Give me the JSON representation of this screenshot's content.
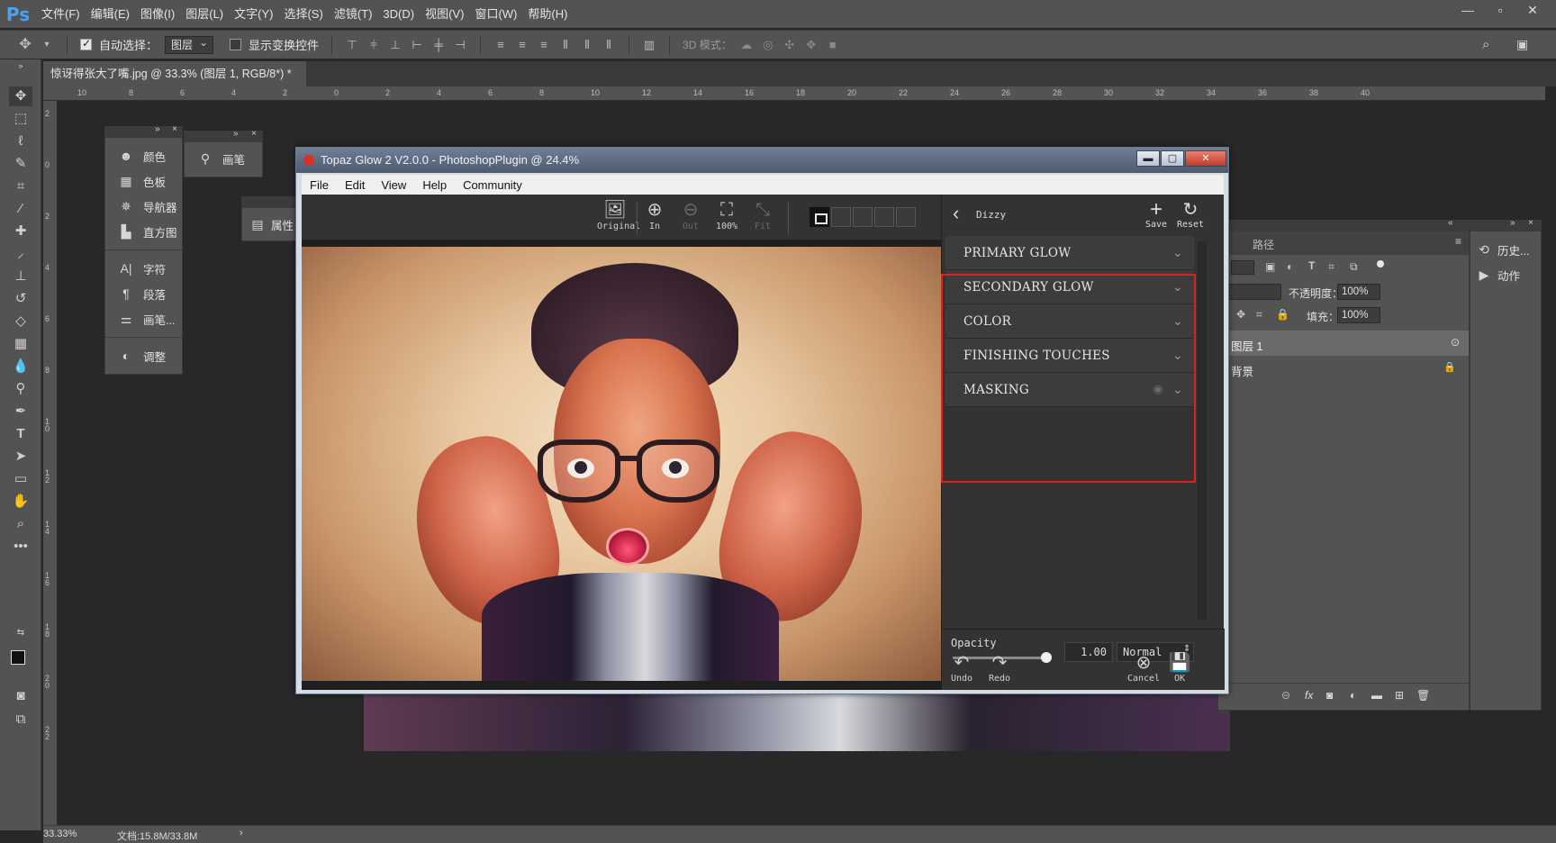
{
  "photoshop": {
    "logo": "Ps",
    "menu": [
      "文件(F)",
      "编辑(E)",
      "图像(I)",
      "图层(L)",
      "文字(Y)",
      "选择(S)",
      "滤镜(T)",
      "3D(D)",
      "视图(V)",
      "窗口(W)",
      "帮助(H)"
    ],
    "options": {
      "auto_select_label": "自动选择：",
      "auto_select_value": "图层",
      "auto_select_checked": true,
      "show_transform_label": "显示变换控件",
      "show_transform_checked": false,
      "mode_3d_label": "3D 模式："
    },
    "document_tab": "惊讶得张大了嘴.jpg @ 33.3% (图层 1, RGB/8*) *",
    "ruler_top_labels": [
      "10",
      "8",
      "6",
      "4",
      "2",
      "0",
      "2",
      "4",
      "6",
      "8",
      "10",
      "12",
      "14",
      "16",
      "18",
      "20",
      "22",
      "24",
      "26",
      "28",
      "30",
      "32",
      "34",
      "36",
      "38",
      "40"
    ],
    "ruler_left_labels": [
      "2",
      "0",
      "2",
      "4",
      "6",
      "8",
      "1 0",
      "1 2",
      "1 4",
      "1 6",
      "1 8",
      "2 0",
      "2 2"
    ],
    "status": {
      "zoom": "33.33%",
      "doc_info": "文档:15.8M/33.8M",
      "arrow": "›"
    }
  },
  "panels": {
    "left_group": [
      {
        "icon": "palette-icon",
        "label": "颜色"
      },
      {
        "icon": "swatches-icon",
        "label": "色板"
      },
      {
        "icon": "navigator-icon",
        "label": "导航器"
      },
      {
        "icon": "histogram-icon",
        "label": "直方图"
      },
      {
        "icon": "character-icon",
        "label": "字符"
      },
      {
        "icon": "paragraph-icon",
        "label": "段落"
      },
      {
        "icon": "brush-settings-icon",
        "label": "画笔..."
      },
      {
        "icon": "adjustments-icon",
        "label": "调整"
      }
    ],
    "brush_panel_label": "画笔",
    "properties_panel_label": "属性",
    "layers": {
      "paths_tab": "路径",
      "opacity_label": "不透明度：",
      "opacity_value": "100%",
      "fill_label": "填充：",
      "fill_value": "100%",
      "rows": [
        "图层 1",
        "背景"
      ]
    },
    "side": {
      "history": "历史...",
      "actions": "动作"
    }
  },
  "topaz": {
    "title": "Topaz Glow 2 V2.0.0 - PhotoshopPlugin @ 24.4%",
    "menu": [
      "File",
      "Edit",
      "View",
      "Help",
      "Community"
    ],
    "toolbar": [
      {
        "icon": "image-icon",
        "label": "Original",
        "enabled": true
      },
      {
        "icon": "zoom-in-icon",
        "label": "In",
        "enabled": true
      },
      {
        "icon": "zoom-out-icon",
        "label": "Out",
        "enabled": false
      },
      {
        "icon": "actual-size-icon",
        "label": "100%",
        "enabled": true
      },
      {
        "icon": "fit-icon",
        "label": "Fit",
        "enabled": false
      }
    ],
    "preset_name": "Dizzy",
    "save_label": "Save",
    "reset_label": "Reset",
    "sections": [
      "PRIMARY GLOW",
      "SECONDARY GLOW",
      "COLOR",
      "FINISHING TOUCHES",
      "MASKING"
    ],
    "opacity_label": "Opacity",
    "opacity_value": "1.00",
    "opacity_fraction": 1.0,
    "blend_mode": "Normal",
    "undo_label": "Undo",
    "redo_label": "Redo",
    "cancel_label": "Cancel",
    "ok_label": "OK",
    "highlight_color": "#e02020"
  }
}
